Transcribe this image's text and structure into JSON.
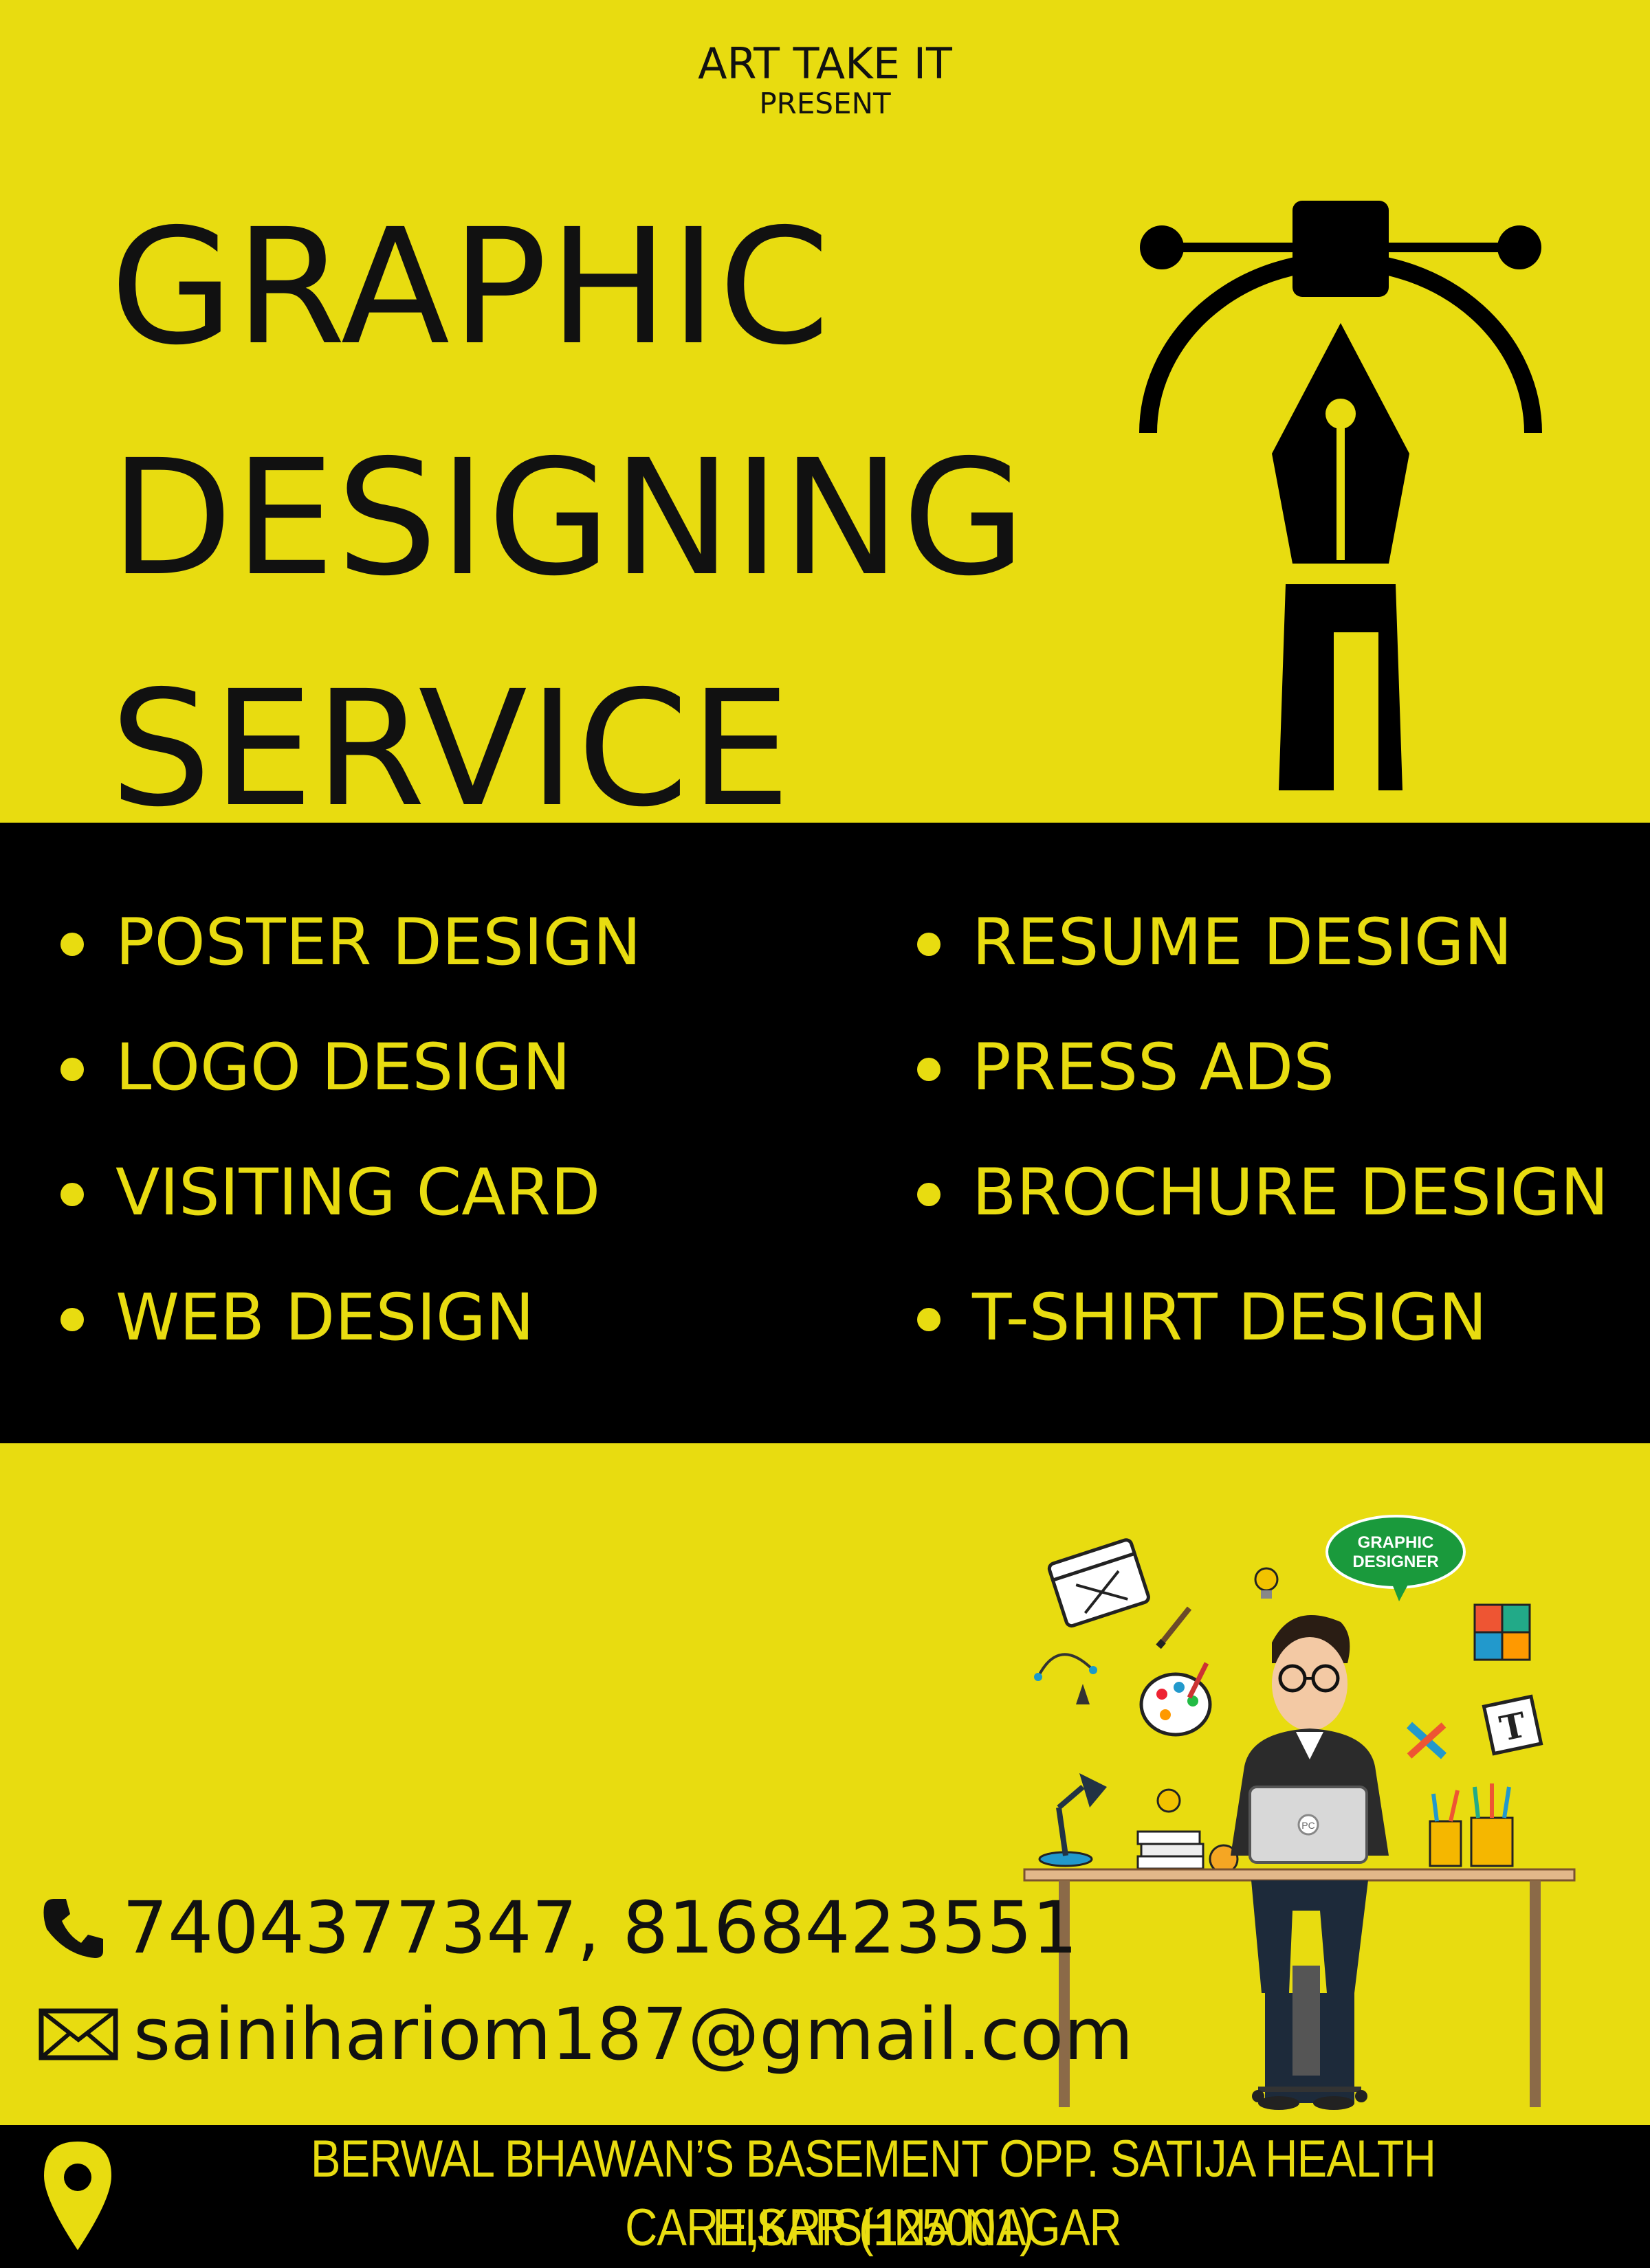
{
  "header": {
    "brand": "ART TAKE IT",
    "present": "PRESENT"
  },
  "headline": {
    "line1": "GRAPHIC",
    "line2": "DESIGNING",
    "line3": "SERVICE"
  },
  "services": {
    "left": [
      "POSTER DESIGN",
      "LOGO DESIGN",
      "VISITING CARD",
      "WEB DESIGN"
    ],
    "right": [
      "RESUME DESIGN",
      "PRESS ADS",
      "BROCHURE DESIGN",
      "T-SHIRT DESIGN"
    ]
  },
  "illustration": {
    "badge_line1": "GRAPHIC",
    "badge_line2": "DESIGNER",
    "laptop_label": "PC",
    "type_icon_letter": "T"
  },
  "contact": {
    "phone": "7404377347, 8168423551",
    "email": "sainihariom187@gmail.com"
  },
  "address": {
    "line1": "BERWAL BHAWAN’S BASEMENT OPP. SATIJA HEALTH CARE,KRISHNA NAGAR",
    "line2": "HISAR (125001)"
  },
  "colors": {
    "background": "#e8dc10",
    "band": "#000000",
    "text_dark": "#111111",
    "text_accent": "#e8dc10"
  }
}
